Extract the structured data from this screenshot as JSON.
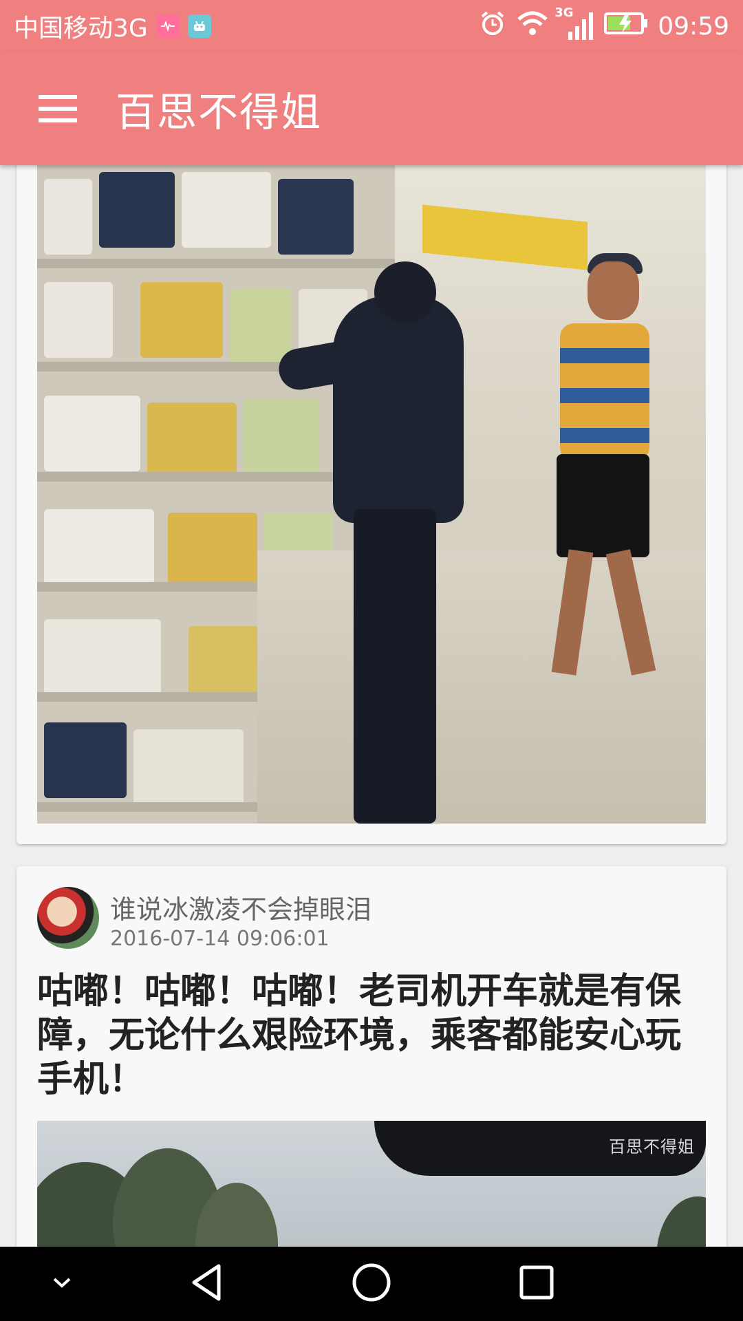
{
  "status_bar": {
    "carrier": "中国移动3G",
    "network": "3G",
    "time": "09:59",
    "icons": [
      "heart-monitor-icon",
      "android-icon",
      "alarm-icon",
      "wifi-icon",
      "signal-icon",
      "battery-charging-icon"
    ]
  },
  "app_bar": {
    "title": "百思不得姐",
    "menu_icon": "hamburger-menu-icon"
  },
  "feed": {
    "posts": [
      {
        "media": "image"
      },
      {
        "user_name": "谁说冰激凌不会掉眼泪",
        "timestamp": "2016-07-14 09:06:01",
        "text": "咕嘟！咕嘟！咕嘟！老司机开车就是有保障，无论什么艰险环境，乘客都能安心玩手机！",
        "watermark": "百思不得姐"
      }
    ]
  },
  "nav_bar": {
    "buttons": [
      "collapse-icon",
      "back-icon",
      "home-icon",
      "recents-icon"
    ]
  },
  "colors": {
    "accent": "#f08080",
    "card_bg": "#f8f8f8",
    "nav_bg": "#000000"
  }
}
